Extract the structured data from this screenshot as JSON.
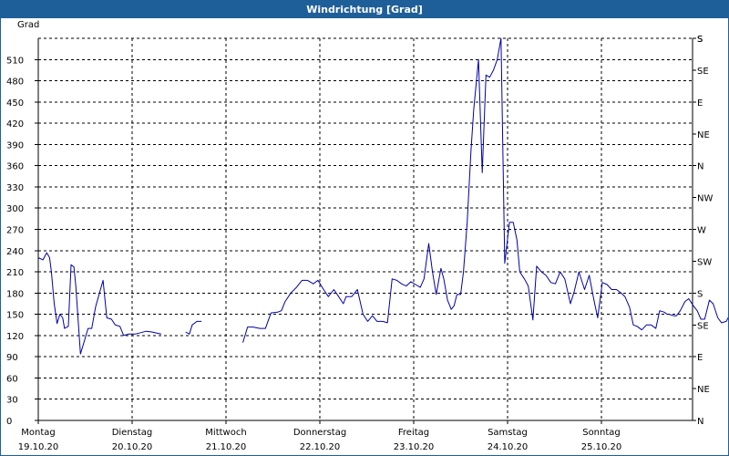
{
  "window": {
    "title": "Windrichtung [Grad]"
  },
  "chart_data": {
    "type": "line",
    "title": "Windrichtung [Grad]",
    "ylabel": "Grad",
    "ylim": [
      0,
      540
    ],
    "yticks": [
      0,
      30,
      60,
      90,
      120,
      150,
      180,
      210,
      240,
      270,
      300,
      330,
      360,
      390,
      420,
      450,
      480,
      510
    ],
    "right_axis_labels": [
      "N",
      "NE",
      "E",
      "SE",
      "S",
      "SW",
      "W",
      "NW",
      "N",
      "NE",
      "E",
      "SE",
      "S"
    ],
    "right_axis_top": "S",
    "xlim": [
      0,
      7
    ],
    "x_unit": "days since 19.10.20",
    "day_labels": [
      {
        "day": "Montag",
        "date": "19.10.20"
      },
      {
        "day": "Dienstag",
        "date": "20.10.20"
      },
      {
        "day": "Mittwoch",
        "date": "21.10.20"
      },
      {
        "day": "Donnerstag",
        "date": "22.10.20"
      },
      {
        "day": "Freitag",
        "date": "23.10.20"
      },
      {
        "day": "Samstag",
        "date": "24.10.20"
      },
      {
        "day": "Sonntag",
        "date": "25.10.20"
      }
    ],
    "grid": true,
    "series": [
      {
        "name": "",
        "color": "#0000aa",
        "points": [
          [
            0.0,
            230
          ],
          [
            0.05,
            227
          ],
          [
            0.09,
            237
          ],
          [
            0.12,
            230
          ],
          [
            0.14,
            210
          ],
          [
            0.17,
            165
          ],
          [
            0.2,
            137
          ],
          [
            0.23,
            150
          ],
          [
            0.26,
            145
          ],
          [
            0.28,
            130
          ],
          [
            0.32,
            133
          ],
          [
            0.35,
            220
          ],
          [
            0.38,
            217
          ],
          [
            0.4,
            190
          ],
          [
            0.45,
            94
          ],
          [
            0.49,
            112
          ],
          [
            0.53,
            130
          ],
          [
            0.57,
            130
          ],
          [
            0.61,
            160
          ],
          [
            0.69,
            198
          ],
          [
            0.73,
            145
          ],
          [
            0.78,
            143
          ],
          [
            0.82,
            135
          ],
          [
            0.87,
            133
          ],
          [
            0.91,
            120
          ],
          [
            0.96,
            122
          ],
          [
            1.03,
            122
          ],
          [
            1.09,
            124
          ],
          [
            1.15,
            126
          ],
          [
            1.21,
            125
          ],
          [
            1.28,
            123
          ],
          [
            1.31,
            122
          ],
          null,
          [
            1.57,
            125
          ],
          [
            1.61,
            122
          ],
          [
            1.64,
            135
          ],
          [
            1.69,
            140
          ],
          [
            1.74,
            140
          ],
          null,
          [
            2.18,
            110
          ],
          [
            2.23,
            132
          ],
          [
            2.29,
            132
          ],
          [
            2.36,
            130
          ],
          [
            2.42,
            130
          ],
          [
            2.48,
            152
          ],
          [
            2.55,
            153
          ],
          [
            2.59,
            155
          ],
          [
            2.63,
            168
          ],
          [
            2.69,
            180
          ],
          [
            2.75,
            188
          ],
          [
            2.81,
            198
          ],
          [
            2.87,
            198
          ],
          [
            2.93,
            193
          ],
          [
            2.98,
            198
          ],
          [
            3.04,
            185
          ],
          [
            3.09,
            175
          ],
          [
            3.15,
            185
          ],
          [
            3.2,
            175
          ],
          [
            3.25,
            165
          ],
          [
            3.28,
            175
          ],
          [
            3.34,
            175
          ],
          [
            3.4,
            185
          ],
          [
            3.46,
            150
          ],
          [
            3.51,
            140
          ],
          [
            3.56,
            148
          ],
          [
            3.61,
            140
          ],
          [
            3.67,
            140
          ],
          [
            3.72,
            138
          ],
          [
            3.77,
            200
          ],
          [
            3.82,
            198
          ],
          [
            3.87,
            193
          ],
          [
            3.92,
            190
          ],
          [
            3.97,
            196
          ],
          [
            4.02,
            192
          ],
          [
            4.07,
            188
          ],
          [
            4.11,
            200
          ],
          [
            4.16,
            250
          ],
          [
            4.2,
            210
          ],
          [
            4.24,
            178
          ],
          [
            4.29,
            215
          ],
          [
            4.32,
            200
          ],
          [
            4.36,
            170
          ],
          [
            4.4,
            157
          ],
          [
            4.43,
            162
          ],
          [
            4.46,
            178
          ],
          [
            4.5,
            178
          ],
          [
            4.53,
            210
          ],
          [
            4.57,
            280
          ],
          [
            4.61,
            380
          ],
          [
            4.64,
            440
          ],
          [
            4.69,
            510
          ],
          [
            4.73,
            350
          ],
          [
            4.77,
            488
          ],
          [
            4.81,
            485
          ],
          [
            4.85,
            495
          ],
          [
            4.89,
            510
          ],
          [
            4.93,
            540
          ],
          [
            4.97,
            222
          ],
          [
            5.02,
            280
          ],
          [
            5.06,
            280
          ],
          [
            5.1,
            255
          ],
          [
            5.13,
            210
          ],
          [
            5.18,
            200
          ],
          [
            5.22,
            190
          ],
          [
            5.27,
            142
          ],
          [
            5.31,
            218
          ],
          [
            5.36,
            210
          ],
          [
            5.41,
            205
          ],
          [
            5.46,
            195
          ],
          [
            5.51,
            193
          ],
          [
            5.56,
            210
          ],
          [
            5.61,
            200
          ],
          [
            5.67,
            165
          ],
          [
            5.71,
            182
          ],
          [
            5.76,
            210
          ],
          [
            5.82,
            185
          ],
          [
            5.87,
            205
          ],
          [
            5.92,
            170
          ],
          [
            5.96,
            145
          ],
          [
            6.01,
            195
          ],
          [
            6.06,
            192
          ],
          [
            6.11,
            185
          ],
          [
            6.16,
            185
          ],
          [
            6.21,
            180
          ],
          [
            6.25,
            175
          ],
          [
            6.3,
            160
          ],
          [
            6.34,
            135
          ],
          [
            6.38,
            133
          ],
          [
            6.43,
            128
          ],
          [
            6.48,
            135
          ],
          [
            6.53,
            135
          ],
          [
            6.58,
            130
          ],
          [
            6.62,
            155
          ],
          [
            6.67,
            153
          ],
          [
            6.7,
            150
          ]
        ]
      },
      {
        "name": "",
        "color": "#0000aa",
        "points": [
          [
            6.72,
            150
          ],
          [
            6.77,
            148
          ],
          [
            6.8,
            148
          ],
          [
            6.84,
            155
          ],
          [
            6.89,
            168
          ],
          [
            6.93,
            172
          ],
          [
            6.98,
            162
          ],
          [
            7.02,
            155
          ],
          [
            7.06,
            143
          ],
          [
            7.1,
            143
          ],
          [
            7.15,
            170
          ],
          [
            7.19,
            165
          ],
          [
            7.24,
            145
          ],
          [
            7.28,
            138
          ],
          [
            7.33,
            140
          ],
          [
            7.37,
            150
          ],
          [
            7.4,
            170
          ],
          [
            7.45,
            148
          ],
          [
            7.49,
            148
          ],
          [
            7.53,
            137
          ],
          [
            7.57,
            133
          ],
          [
            7.61,
            133
          ]
        ]
      }
    ]
  }
}
